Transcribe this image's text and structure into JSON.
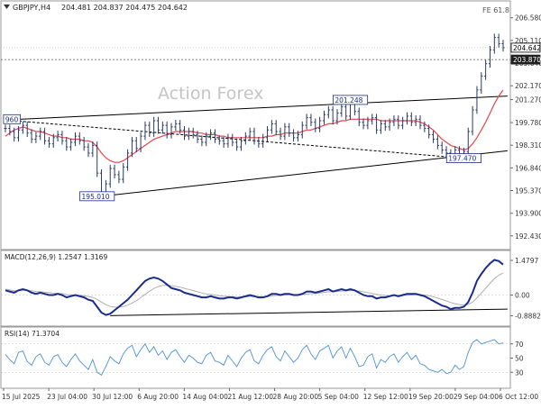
{
  "header": {
    "symbol": "GBPJPY,H4",
    "ohlc": "204.481 204.837 204.475 204.642",
    "fe_label": "FE 61.8"
  },
  "watermark": "Action Forex",
  "colors": {
    "price": "#2a3a63",
    "ma": "#e8454a",
    "macd": "#1a2b8e",
    "signal": "#b0b0b0",
    "rsi": "#4a90d9",
    "trend": "#000000",
    "label_border": "#1a2b8e",
    "label_text": "#1a2b8e",
    "grid": "#d0d0d0"
  },
  "chart_data": [
    {
      "type": "line",
      "title": "GBPJPY,H4",
      "yticks": [
        "206.580",
        "205.110",
        "203.640",
        "202.170",
        "201.270",
        "199.780",
        "198.310",
        "196.840",
        "195.370",
        "193.900",
        "192.430"
      ],
      "ytick_values": [
        206.58,
        205.11,
        203.64,
        202.17,
        201.27,
        199.78,
        198.31,
        196.84,
        195.37,
        193.9,
        192.43
      ],
      "ylim": [
        191.6,
        207.5
      ],
      "xticks": [
        "15 Jul 2025",
        "23 Jul 04:00",
        "30 Jul 12:00",
        "6 Aug 20:00",
        "14 Aug 04:00",
        "21 Aug 12:00",
        "28 Aug 20:00",
        "5 Sep 04:00",
        "12 Sep 12:00",
        "19 Sep 20:00",
        "29 Sep 04:00",
        "6 Oct 12:00"
      ],
      "price_labels": {
        "current": "204.642",
        "level": "203.870"
      },
      "annotations": [
        {
          "text": "960",
          "x": 1.5,
          "y": 200.0
        },
        {
          "text": "201.248",
          "x": 79,
          "y": 201.25
        },
        {
          "text": "195.010",
          "x": 21,
          "y": 195.0
        },
        {
          "text": "197.470",
          "x": 105,
          "y": 197.47
        }
      ],
      "series": [
        {
          "name": "price",
          "values": [
            199.4,
            199.2,
            198.8,
            199.3,
            199.6,
            199.1,
            198.7,
            198.9,
            199.2,
            198.6,
            198.4,
            198.8,
            199.0,
            198.6,
            198.2,
            198.5,
            198.9,
            198.6,
            198.2,
            197.8,
            198.3,
            196.5,
            195.2,
            195.8,
            196.8,
            196.4,
            196.1,
            196.9,
            197.8,
            198.6,
            198.1,
            198.9,
            199.6,
            199.1,
            199.9,
            199.3,
            199.6,
            199.0,
            199.5,
            199.7,
            199.3,
            198.9,
            199.2,
            199.0,
            198.7,
            198.5,
            198.9,
            199.1,
            198.7,
            198.6,
            198.4,
            198.8,
            198.5,
            198.2,
            198.6,
            198.9,
            199.2,
            198.6,
            198.4,
            198.8,
            199.3,
            199.7,
            199.2,
            198.9,
            199.5,
            199.1,
            198.8,
            199.0,
            199.6,
            200.1,
            199.8,
            199.4,
            199.9,
            200.3,
            200.6,
            199.9,
            200.4,
            200.8,
            200.2,
            201.0,
            200.5,
            199.8,
            199.6,
            199.9,
            200.1,
            199.3,
            199.7,
            199.5,
            199.8,
            200.0,
            199.6,
            199.9,
            200.2,
            199.8,
            200.0,
            199.6,
            199.4,
            199.0,
            198.7,
            198.3,
            198.0,
            197.8,
            197.5,
            198.0,
            197.6,
            197.9,
            199.2,
            200.6,
            201.9,
            202.8,
            203.6,
            204.5,
            205.3,
            204.9,
            204.64
          ]
        },
        {
          "name": "ma",
          "values": [
            198.9,
            199.1,
            199.3,
            199.4,
            199.5,
            199.4,
            199.3,
            199.2,
            199.2,
            199.1,
            199.0,
            198.9,
            198.9,
            198.8,
            198.8,
            198.7,
            198.7,
            198.7,
            198.6,
            198.6,
            198.5,
            198.2,
            197.8,
            197.5,
            197.3,
            197.2,
            197.2,
            197.3,
            197.5,
            197.7,
            197.9,
            198.1,
            198.3,
            198.5,
            198.7,
            198.8,
            198.9,
            199.0,
            199.1,
            199.2,
            199.2,
            199.2,
            199.2,
            199.2,
            199.1,
            199.1,
            199.0,
            199.0,
            199.0,
            198.9,
            198.9,
            198.8,
            198.8,
            198.8,
            198.8,
            198.8,
            198.8,
            198.8,
            198.8,
            198.8,
            198.9,
            198.9,
            199.0,
            199.0,
            199.1,
            199.1,
            199.1,
            199.1,
            199.2,
            199.3,
            199.3,
            199.4,
            199.5,
            199.6,
            199.7,
            199.7,
            199.8,
            199.9,
            199.9,
            200.0,
            200.0,
            200.0,
            200.0,
            200.0,
            200.0,
            200.0,
            199.9,
            199.9,
            199.9,
            199.9,
            199.9,
            199.9,
            199.9,
            199.9,
            199.9,
            199.8,
            199.7,
            199.5,
            199.3,
            199.0,
            198.7,
            198.5,
            198.3,
            198.2,
            198.1,
            198.0,
            198.1,
            198.4,
            198.8,
            199.3,
            199.8,
            200.4,
            201.0,
            201.5,
            201.9
          ]
        }
      ],
      "trendlines": [
        {
          "x1": 0,
          "y1": 199.95,
          "x2": 115,
          "y2": 201.5
        },
        {
          "x1": 22,
          "y1": 195.0,
          "x2": 115,
          "y2": 197.95
        },
        {
          "x1": 0,
          "y1": 199.95,
          "x2": 105,
          "y2": 197.47
        }
      ],
      "hline": 203.87
    },
    {
      "type": "line",
      "title": "MACD(12,26,9) 1.2547 1.3169",
      "yticks": [
        "1.4797",
        "0.00",
        "-0.8882"
      ],
      "ytick_values": [
        1.4797,
        0.0,
        -0.8882
      ],
      "ylim": [
        -1.25,
        1.75
      ],
      "series": [
        {
          "name": "macd",
          "values": [
            0.2,
            0.15,
            0.1,
            0.2,
            0.25,
            0.2,
            0.1,
            0.05,
            0.1,
            0.05,
            0.0,
            0.0,
            0.05,
            0.0,
            -0.1,
            -0.05,
            0.0,
            -0.05,
            -0.1,
            -0.2,
            -0.25,
            -0.5,
            -0.75,
            -0.85,
            -0.8,
            -0.65,
            -0.5,
            -0.35,
            -0.2,
            0.0,
            0.2,
            0.4,
            0.6,
            0.7,
            0.75,
            0.7,
            0.6,
            0.45,
            0.3,
            0.25,
            0.2,
            0.1,
            0.05,
            0.0,
            -0.05,
            -0.1,
            -0.1,
            -0.05,
            -0.1,
            -0.15,
            -0.15,
            -0.1,
            -0.1,
            -0.15,
            -0.1,
            -0.05,
            0.0,
            -0.05,
            -0.1,
            -0.1,
            -0.05,
            0.05,
            0.05,
            0.0,
            0.05,
            0.05,
            0.0,
            0.0,
            0.05,
            0.15,
            0.15,
            0.1,
            0.15,
            0.2,
            0.25,
            0.15,
            0.2,
            0.25,
            0.2,
            0.25,
            0.2,
            0.1,
            0.0,
            -0.05,
            -0.05,
            -0.15,
            -0.1,
            -0.1,
            -0.05,
            0.0,
            -0.05,
            0.0,
            0.05,
            0.05,
            0.05,
            0.0,
            -0.05,
            -0.15,
            -0.25,
            -0.35,
            -0.45,
            -0.5,
            -0.6,
            -0.55,
            -0.55,
            -0.5,
            -0.3,
            0.1,
            0.6,
            0.9,
            1.15,
            1.35,
            1.5,
            1.45,
            1.3
          ]
        },
        {
          "name": "signal",
          "values": [
            0.25,
            0.22,
            0.18,
            0.19,
            0.2,
            0.2,
            0.18,
            0.15,
            0.14,
            0.12,
            0.1,
            0.08,
            0.07,
            0.06,
            0.02,
            0.01,
            0.0,
            -0.01,
            -0.03,
            -0.06,
            -0.1,
            -0.18,
            -0.3,
            -0.41,
            -0.49,
            -0.52,
            -0.52,
            -0.49,
            -0.43,
            -0.35,
            -0.24,
            -0.11,
            0.03,
            0.16,
            0.28,
            0.36,
            0.41,
            0.42,
            0.4,
            0.37,
            0.34,
            0.29,
            0.24,
            0.19,
            0.14,
            0.09,
            0.05,
            0.03,
            0.0,
            -0.03,
            -0.05,
            -0.06,
            -0.07,
            -0.09,
            -0.09,
            -0.08,
            -0.06,
            -0.06,
            -0.07,
            -0.07,
            -0.07,
            -0.04,
            -0.02,
            -0.02,
            0.0,
            0.01,
            0.01,
            0.01,
            0.02,
            0.04,
            0.06,
            0.07,
            0.09,
            0.11,
            0.14,
            0.14,
            0.15,
            0.17,
            0.18,
            0.19,
            0.19,
            0.17,
            0.14,
            0.1,
            0.07,
            0.03,
            0.0,
            -0.02,
            -0.03,
            -0.02,
            -0.03,
            -0.02,
            -0.01,
            0.0,
            0.01,
            0.01,
            0.0,
            -0.03,
            -0.07,
            -0.13,
            -0.19,
            -0.25,
            -0.32,
            -0.37,
            -0.41,
            -0.43,
            -0.4,
            -0.3,
            -0.12,
            0.08,
            0.29,
            0.5,
            0.7,
            0.85,
            0.94
          ]
        }
      ],
      "trendlines": [
        {
          "x1": 24,
          "y1": -0.88,
          "x2": 115,
          "y2": -0.6
        }
      ]
    },
    {
      "type": "line",
      "title": "RSI(14) 71.3704",
      "yticks": [
        "70",
        "50",
        "30"
      ],
      "ytick_values": [
        70,
        50,
        30
      ],
      "ylim": [
        10,
        90
      ],
      "series": [
        {
          "name": "rsi",
          "values": [
            55,
            48,
            42,
            58,
            60,
            45,
            40,
            52,
            56,
            44,
            40,
            52,
            55,
            44,
            38,
            48,
            56,
            46,
            40,
            34,
            48,
            30,
            26,
            38,
            52,
            46,
            42,
            56,
            64,
            68,
            52,
            62,
            70,
            58,
            66,
            54,
            60,
            48,
            58,
            62,
            52,
            44,
            54,
            50,
            44,
            42,
            54,
            58,
            46,
            44,
            40,
            54,
            46,
            38,
            50,
            58,
            62,
            46,
            42,
            54,
            62,
            66,
            52,
            46,
            60,
            52,
            44,
            50,
            62,
            68,
            56,
            48,
            60,
            64,
            68,
            50,
            60,
            66,
            50,
            64,
            52,
            38,
            40,
            52,
            56,
            36,
            48,
            44,
            52,
            56,
            44,
            52,
            58,
            48,
            54,
            42,
            40,
            34,
            32,
            30,
            34,
            28,
            30,
            40,
            34,
            38,
            58,
            72,
            76,
            70,
            72,
            74,
            76,
            70,
            71.37
          ]
        }
      ]
    }
  ]
}
